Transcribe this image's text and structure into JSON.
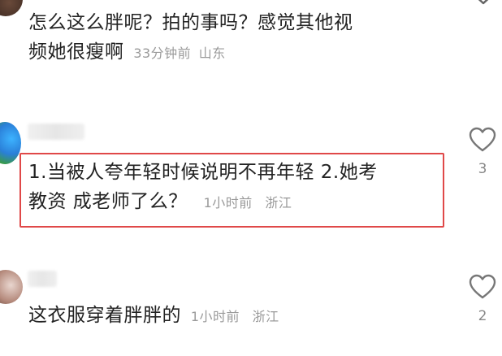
{
  "comments": [
    {
      "text_line1": "怎么这么胖呢？拍的事吗？感觉其他视",
      "text_line2": "频她很瘦啊",
      "time": "33分钟前",
      "location": "山东"
    },
    {
      "text_line1": "1.当被人夸年轻时候说明不再年轻 2.她考",
      "text_line2": "教资 成老师了么？",
      "time": "1小时前",
      "location": "浙江",
      "likes": "3"
    },
    {
      "text_line1": "这衣服穿着胖胖的",
      "time": "1小时前",
      "location": "浙江",
      "likes": "2"
    }
  ],
  "colors": {
    "highlight_border": "#e04848",
    "meta_text": "#9a9a9a",
    "body_text": "#222222"
  },
  "icons": {
    "like": "heart-outline-icon",
    "more": "chevron-down-icon"
  }
}
